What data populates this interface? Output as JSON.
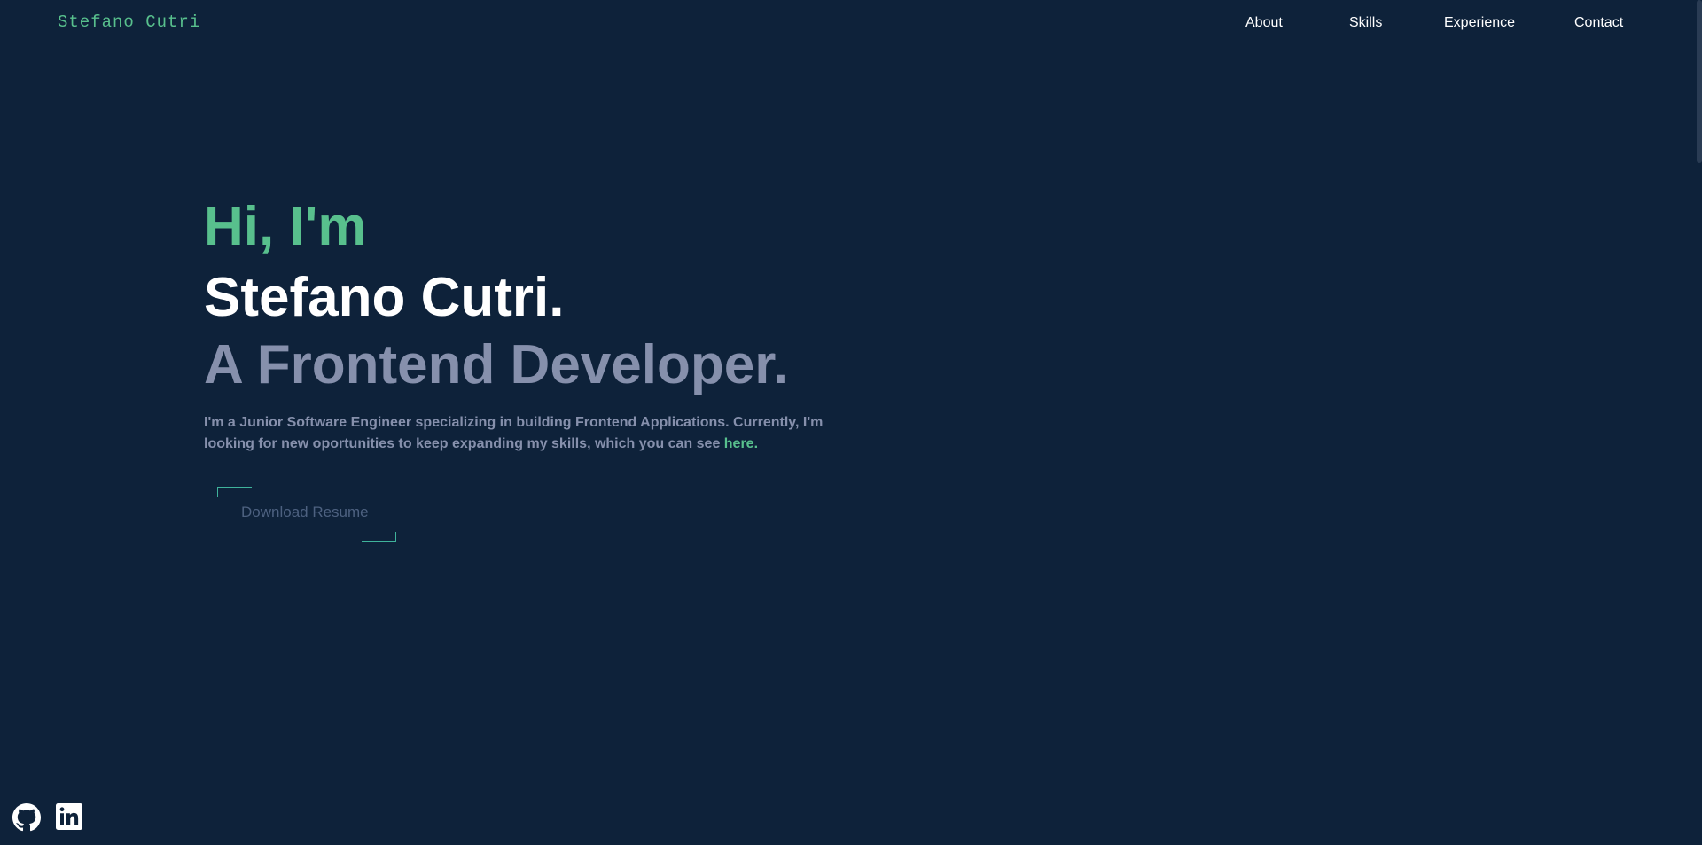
{
  "header": {
    "brand": "Stefano Cutri",
    "nav": [
      {
        "label": "About"
      },
      {
        "label": "Skills"
      },
      {
        "label": "Experience"
      },
      {
        "label": "Contact"
      }
    ]
  },
  "hero": {
    "greeting": "Hi, I'm",
    "name": "Stefano Cutri.",
    "role": "A Frontend Developer.",
    "intro_text": "I'm a Junior Software Engineer specializing in building Frontend Applications. Currently, I'm looking for new oportunities to keep expanding my skills, which you can see ",
    "intro_link": "here.",
    "resume_button": "Download Resume"
  },
  "social": [
    {
      "icon": "github-icon"
    },
    {
      "icon": "linkedin-icon"
    }
  ],
  "colors": {
    "background": "#0e223a",
    "accent": "#58c08d",
    "muted": "#8690ac",
    "button_border": "#3fb39b"
  }
}
